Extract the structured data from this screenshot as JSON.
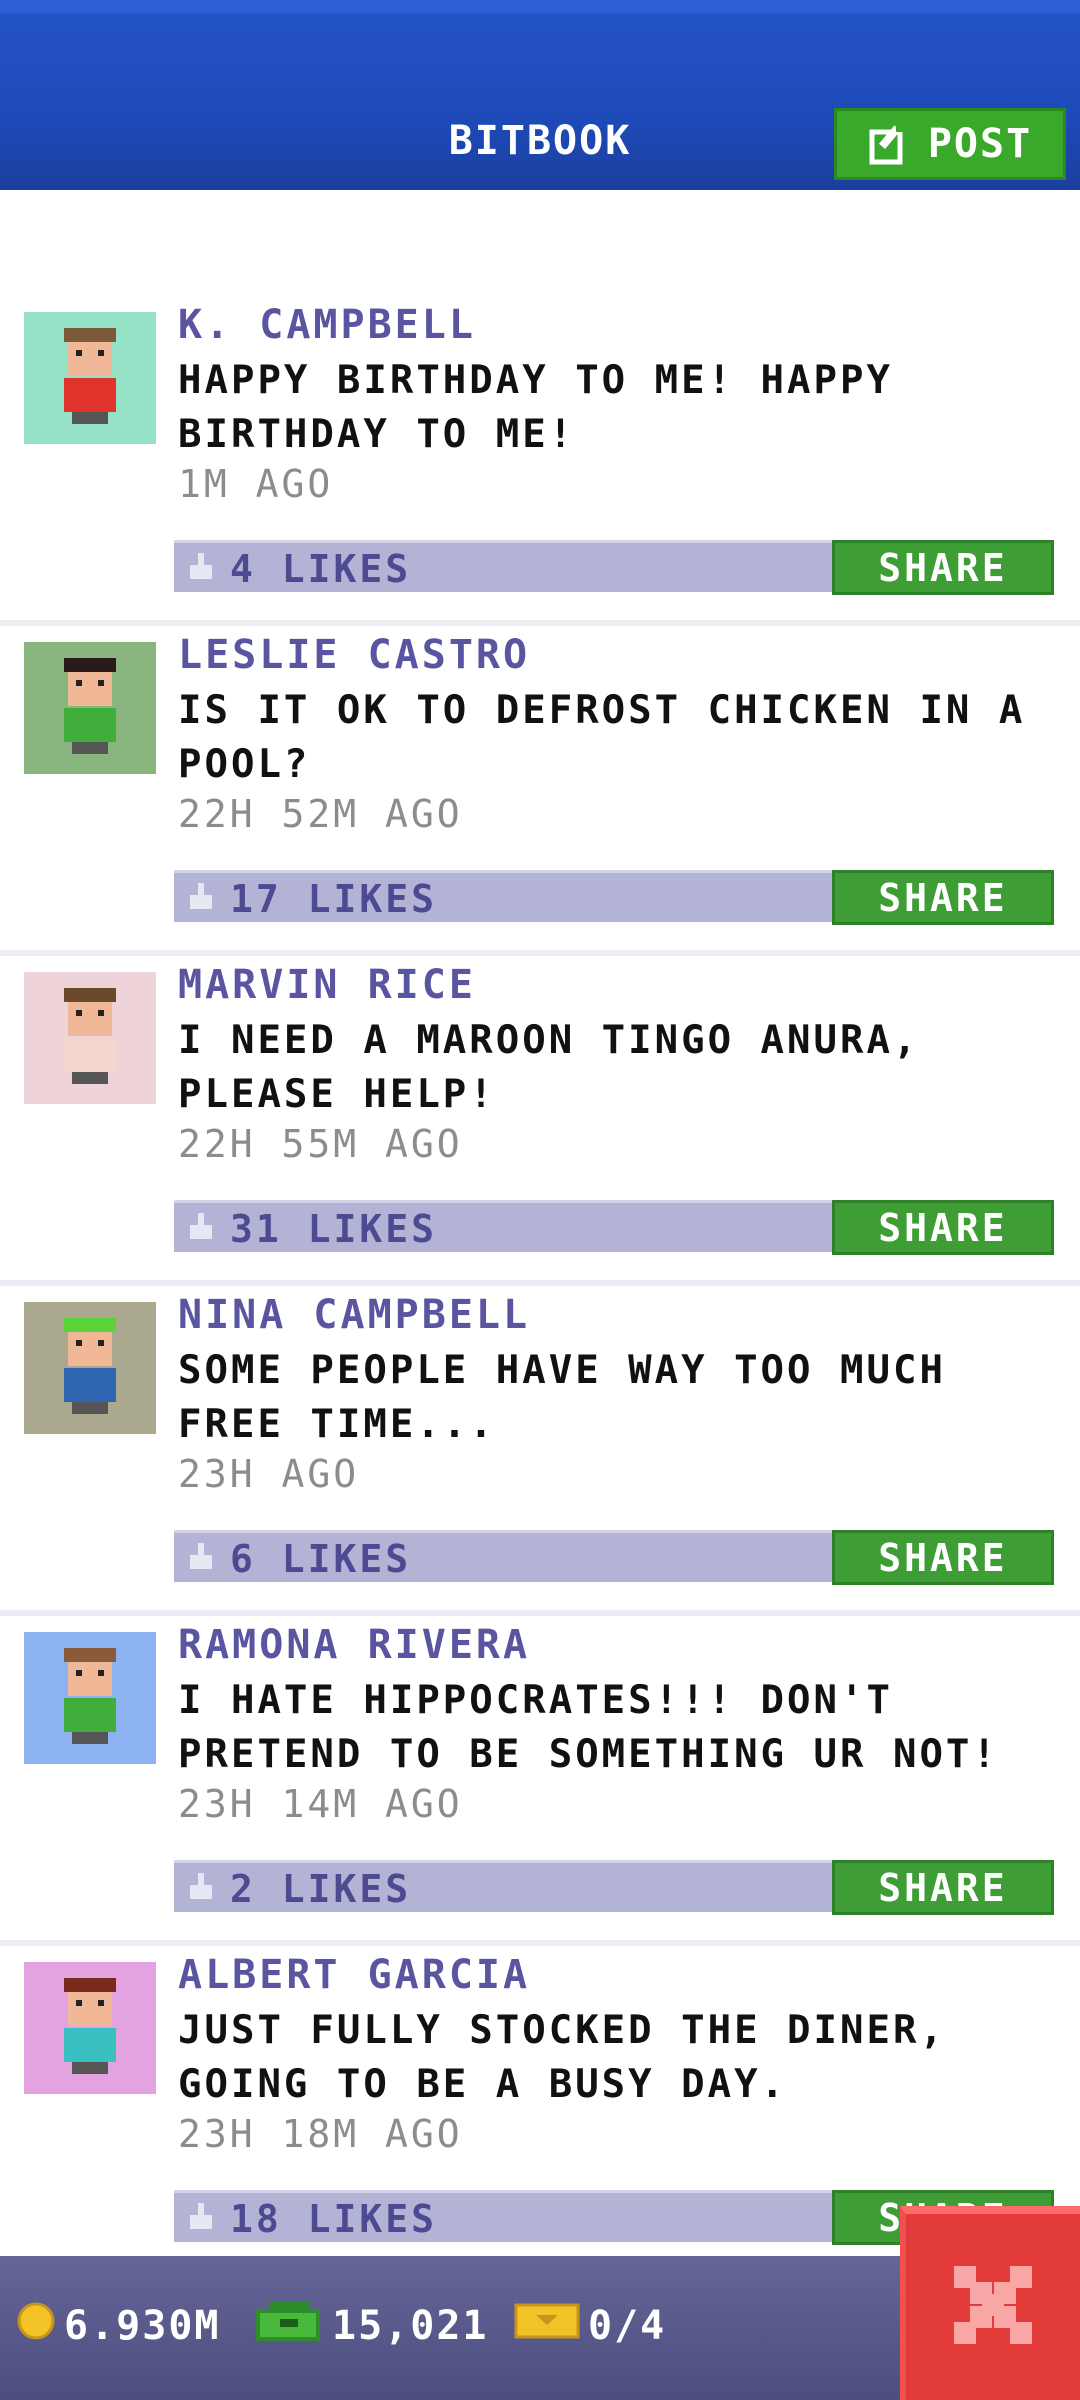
{
  "header": {
    "title": "BITBOOK",
    "post_label": "POST",
    "colors": {
      "bar": "#1e4ab8",
      "post_button": "#3aa82b"
    }
  },
  "posts": [
    {
      "author": "K. CAMPBELL",
      "message": "HAPPY BIRTHDAY TO ME! HAPPY BIRTHDAY TO ME!",
      "time": "1M AGO",
      "likes": "4 LIKES",
      "share_label": "SHARE",
      "avatar_bg": "#95e2c6",
      "avatar_shirt": "#e0332b",
      "avatar_hair": "#7a5a3a"
    },
    {
      "author": "LESLIE CASTRO",
      "message": "IS IT OK TO DEFROST CHICKEN IN A POOL?",
      "time": "22H 52M AGO",
      "likes": "17 LIKES",
      "share_label": "SHARE",
      "avatar_bg": "#88b47e",
      "avatar_shirt": "#3fae3a",
      "avatar_hair": "#2a1a1a"
    },
    {
      "author": "MARVIN RICE",
      "message": "I NEED A MAROON TINGO ANURA, PLEASE HELP!",
      "time": "22H 55M AGO",
      "likes": "31 LIKES",
      "share_label": "SHARE",
      "avatar_bg": "#eed4d8",
      "avatar_shirt": "#f4d6d0",
      "avatar_hair": "#6b4a2a"
    },
    {
      "author": "NINA CAMPBELL",
      "message": "SOME PEOPLE HAVE WAY TOO MUCH FREE TIME...",
      "time": "23H AGO",
      "likes": "6 LIKES",
      "share_label": "SHARE",
      "avatar_bg": "#aaa88e",
      "avatar_shirt": "#2f65b0",
      "avatar_hair": "#5ad33a"
    },
    {
      "author": "RAMONA RIVERA",
      "message": "I HATE HIPPOCRATES!!! DON'T PRETEND TO BE SOMETHING UR NOT!",
      "time": "23H 14M AGO",
      "likes": "2 LIKES",
      "share_label": "SHARE",
      "avatar_bg": "#8cb2f2",
      "avatar_shirt": "#3fae3a",
      "avatar_hair": "#8a5a3a"
    },
    {
      "author": "ALBERT GARCIA",
      "message": "JUST FULLY STOCKED THE DINER, GOING TO BE A BUSY DAY.",
      "time": "23H 18M AGO",
      "likes": "18 LIKES",
      "share_label": "SHARE",
      "avatar_bg": "#e3a2e0",
      "avatar_shirt": "#39c0c0",
      "avatar_hair": "#7a2a1a"
    }
  ],
  "footer": {
    "coins": "6.930M",
    "bux": "15,021",
    "tickets": "0/4"
  },
  "icons": {
    "post": "edit-icon",
    "like": "thumbs-up-icon",
    "coins": "coin-icon",
    "bux": "bux-icon",
    "tickets": "ticket-icon",
    "close": "close-icon"
  }
}
